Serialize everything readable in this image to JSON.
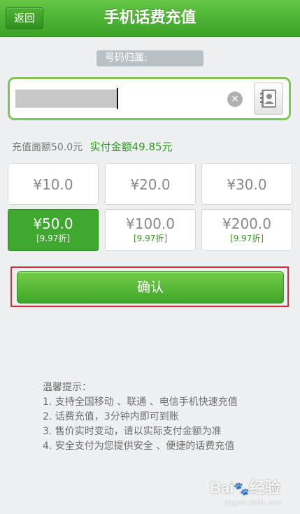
{
  "header": {
    "back_label": "返回",
    "title": "手机话费充值"
  },
  "attribution": {
    "label": "号码归属:"
  },
  "phone": {
    "value": ""
  },
  "summary": {
    "face_value": "充值面额50.0元",
    "paid_amount": "实付金额49.85元"
  },
  "amount_options": [
    {
      "price": "¥10.0",
      "discount": "",
      "selected": false
    },
    {
      "price": "¥20.0",
      "discount": "",
      "selected": false
    },
    {
      "price": "¥30.0",
      "discount": "",
      "selected": false
    },
    {
      "price": "¥50.0",
      "discount": "[9.97折]",
      "selected": true
    },
    {
      "price": "¥100.0",
      "discount": "[9.97折]",
      "selected": false
    },
    {
      "price": "¥200.0",
      "discount": "[9.97折]",
      "selected": false
    }
  ],
  "confirm_label": "确认",
  "tips": {
    "heading": "温馨提示：",
    "items": [
      "1. 支持全国移动 、联通 、电信手机快速充值",
      "2. 话费充值，3分钟内即可到账",
      "3. 售价实时变动，请以实际支付金额为准",
      "4. 安全支付为您提供安全 、便捷的话费充值"
    ]
  },
  "watermark": {
    "text": "Bai",
    "suffix": "经验",
    "url": "jingyan.baidu.com"
  },
  "colors": {
    "header_green": "#4cb335",
    "selected_green": "#3ea92e",
    "pay_text_green": "#2f9a22",
    "highlight_red": "#d82c3b"
  }
}
